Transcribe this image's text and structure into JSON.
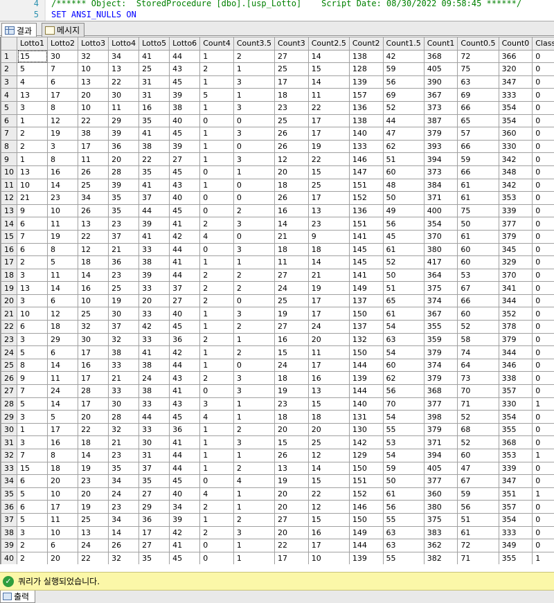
{
  "editor": {
    "lines": [
      {
        "number": "4",
        "text": "/****** Object:  StoredProcedure [dbo].[usp_Lotto]    Script Date: 08/30/2022 09:58:45 ******/"
      },
      {
        "number": "5",
        "text": "SET ANSI_NULLS ON"
      }
    ]
  },
  "tabs": {
    "results_label": "결과",
    "messages_label": "메시지"
  },
  "grid": {
    "columns": [
      "Lotto1",
      "Lotto2",
      "Lotto3",
      "Lotto4",
      "Lotto5",
      "Lotto6",
      "Count4",
      "Count3.5",
      "Count3",
      "Count2.5",
      "Count2",
      "Count1.5",
      "Count1",
      "Count0.5",
      "Count0",
      "Class"
    ],
    "rows": [
      [
        "15",
        "30",
        "32",
        "34",
        "41",
        "44",
        "1",
        "2",
        "27",
        "14",
        "138",
        "42",
        "368",
        "72",
        "366",
        "0"
      ],
      [
        "5",
        "7",
        "10",
        "13",
        "25",
        "43",
        "2",
        "1",
        "25",
        "15",
        "128",
        "59",
        "405",
        "75",
        "320",
        "0"
      ],
      [
        "4",
        "6",
        "13",
        "22",
        "31",
        "45",
        "1",
        "3",
        "17",
        "14",
        "139",
        "56",
        "390",
        "63",
        "347",
        "0"
      ],
      [
        "13",
        "17",
        "20",
        "30",
        "31",
        "39",
        "5",
        "1",
        "18",
        "11",
        "157",
        "69",
        "367",
        "69",
        "333",
        "0"
      ],
      [
        "3",
        "8",
        "10",
        "11",
        "16",
        "38",
        "1",
        "3",
        "23",
        "22",
        "136",
        "52",
        "373",
        "66",
        "354",
        "0"
      ],
      [
        "1",
        "12",
        "22",
        "29",
        "35",
        "40",
        "0",
        "0",
        "25",
        "17",
        "138",
        "44",
        "387",
        "65",
        "354",
        "0"
      ],
      [
        "2",
        "19",
        "38",
        "39",
        "41",
        "45",
        "1",
        "3",
        "26",
        "17",
        "140",
        "47",
        "379",
        "57",
        "360",
        "0"
      ],
      [
        "2",
        "3",
        "17",
        "36",
        "38",
        "39",
        "1",
        "0",
        "26",
        "19",
        "133",
        "62",
        "393",
        "66",
        "330",
        "0"
      ],
      [
        "1",
        "8",
        "11",
        "20",
        "22",
        "27",
        "1",
        "3",
        "12",
        "22",
        "146",
        "51",
        "394",
        "59",
        "342",
        "0"
      ],
      [
        "13",
        "16",
        "26",
        "28",
        "35",
        "45",
        "0",
        "1",
        "20",
        "15",
        "147",
        "60",
        "373",
        "66",
        "348",
        "0"
      ],
      [
        "10",
        "14",
        "25",
        "39",
        "41",
        "43",
        "1",
        "0",
        "18",
        "25",
        "151",
        "48",
        "384",
        "61",
        "342",
        "0"
      ],
      [
        "21",
        "23",
        "34",
        "35",
        "37",
        "40",
        "0",
        "0",
        "26",
        "17",
        "152",
        "50",
        "371",
        "61",
        "353",
        "0"
      ],
      [
        "9",
        "10",
        "26",
        "35",
        "44",
        "45",
        "0",
        "2",
        "16",
        "13",
        "136",
        "49",
        "400",
        "75",
        "339",
        "0"
      ],
      [
        "6",
        "11",
        "13",
        "23",
        "39",
        "41",
        "2",
        "3",
        "14",
        "23",
        "151",
        "56",
        "354",
        "50",
        "377",
        "0"
      ],
      [
        "7",
        "19",
        "22",
        "37",
        "41",
        "42",
        "4",
        "0",
        "21",
        "9",
        "141",
        "45",
        "370",
        "61",
        "379",
        "0"
      ],
      [
        "6",
        "8",
        "12",
        "21",
        "33",
        "44",
        "0",
        "3",
        "18",
        "18",
        "145",
        "61",
        "380",
        "60",
        "345",
        "0"
      ],
      [
        "2",
        "5",
        "18",
        "36",
        "38",
        "41",
        "1",
        "1",
        "11",
        "14",
        "145",
        "52",
        "417",
        "60",
        "329",
        "0"
      ],
      [
        "3",
        "11",
        "14",
        "23",
        "39",
        "44",
        "2",
        "2",
        "27",
        "21",
        "141",
        "50",
        "364",
        "53",
        "370",
        "0"
      ],
      [
        "13",
        "14",
        "16",
        "25",
        "33",
        "37",
        "2",
        "2",
        "24",
        "19",
        "149",
        "51",
        "375",
        "67",
        "341",
        "0"
      ],
      [
        "3",
        "6",
        "10",
        "19",
        "20",
        "27",
        "2",
        "0",
        "25",
        "17",
        "137",
        "65",
        "374",
        "66",
        "344",
        "0"
      ],
      [
        "10",
        "12",
        "25",
        "30",
        "33",
        "40",
        "1",
        "3",
        "19",
        "17",
        "150",
        "61",
        "367",
        "60",
        "352",
        "0"
      ],
      [
        "6",
        "18",
        "32",
        "37",
        "42",
        "45",
        "1",
        "2",
        "27",
        "24",
        "137",
        "54",
        "355",
        "52",
        "378",
        "0"
      ],
      [
        "3",
        "29",
        "30",
        "32",
        "33",
        "36",
        "2",
        "1",
        "16",
        "20",
        "132",
        "63",
        "359",
        "58",
        "379",
        "0"
      ],
      [
        "5",
        "6",
        "17",
        "38",
        "41",
        "42",
        "1",
        "2",
        "15",
        "11",
        "150",
        "54",
        "379",
        "74",
        "344",
        "0"
      ],
      [
        "8",
        "14",
        "16",
        "33",
        "38",
        "44",
        "1",
        "0",
        "24",
        "17",
        "144",
        "60",
        "374",
        "64",
        "346",
        "0"
      ],
      [
        "9",
        "11",
        "17",
        "21",
        "24",
        "43",
        "2",
        "3",
        "18",
        "16",
        "139",
        "62",
        "379",
        "73",
        "338",
        "0"
      ],
      [
        "7",
        "24",
        "28",
        "33",
        "38",
        "41",
        "0",
        "3",
        "19",
        "13",
        "144",
        "56",
        "368",
        "70",
        "357",
        "0"
      ],
      [
        "5",
        "14",
        "17",
        "30",
        "33",
        "43",
        "3",
        "1",
        "23",
        "15",
        "140",
        "70",
        "377",
        "71",
        "330",
        "1"
      ],
      [
        "3",
        "5",
        "20",
        "28",
        "44",
        "45",
        "4",
        "1",
        "18",
        "18",
        "131",
        "54",
        "398",
        "52",
        "354",
        "0"
      ],
      [
        "1",
        "17",
        "22",
        "32",
        "33",
        "36",
        "1",
        "2",
        "20",
        "20",
        "130",
        "55",
        "379",
        "68",
        "355",
        "0"
      ],
      [
        "3",
        "16",
        "18",
        "21",
        "30",
        "41",
        "1",
        "3",
        "15",
        "25",
        "142",
        "53",
        "371",
        "52",
        "368",
        "0"
      ],
      [
        "7",
        "8",
        "14",
        "23",
        "31",
        "44",
        "1",
        "1",
        "26",
        "12",
        "129",
        "54",
        "394",
        "60",
        "353",
        "1"
      ],
      [
        "15",
        "18",
        "19",
        "35",
        "37",
        "44",
        "1",
        "2",
        "13",
        "14",
        "150",
        "59",
        "405",
        "47",
        "339",
        "0"
      ],
      [
        "6",
        "20",
        "23",
        "34",
        "35",
        "45",
        "0",
        "4",
        "19",
        "15",
        "151",
        "50",
        "377",
        "67",
        "347",
        "0"
      ],
      [
        "5",
        "10",
        "20",
        "24",
        "27",
        "40",
        "4",
        "1",
        "20",
        "22",
        "152",
        "61",
        "360",
        "59",
        "351",
        "1"
      ],
      [
        "6",
        "17",
        "19",
        "23",
        "29",
        "34",
        "2",
        "1",
        "20",
        "12",
        "146",
        "56",
        "380",
        "56",
        "357",
        "0"
      ],
      [
        "5",
        "11",
        "25",
        "34",
        "36",
        "39",
        "1",
        "2",
        "27",
        "15",
        "150",
        "55",
        "375",
        "51",
        "354",
        "0"
      ],
      [
        "3",
        "10",
        "13",
        "14",
        "17",
        "42",
        "2",
        "3",
        "20",
        "16",
        "149",
        "63",
        "383",
        "61",
        "333",
        "0"
      ],
      [
        "2",
        "6",
        "24",
        "26",
        "27",
        "41",
        "0",
        "1",
        "22",
        "17",
        "144",
        "63",
        "362",
        "72",
        "349",
        "0"
      ],
      [
        "2",
        "20",
        "22",
        "32",
        "35",
        "45",
        "0",
        "1",
        "17",
        "10",
        "139",
        "55",
        "382",
        "71",
        "355",
        "1"
      ]
    ]
  },
  "status": {
    "message": "쿼리가 실행되었습니다."
  },
  "bottom_tab": {
    "label": "출력"
  }
}
